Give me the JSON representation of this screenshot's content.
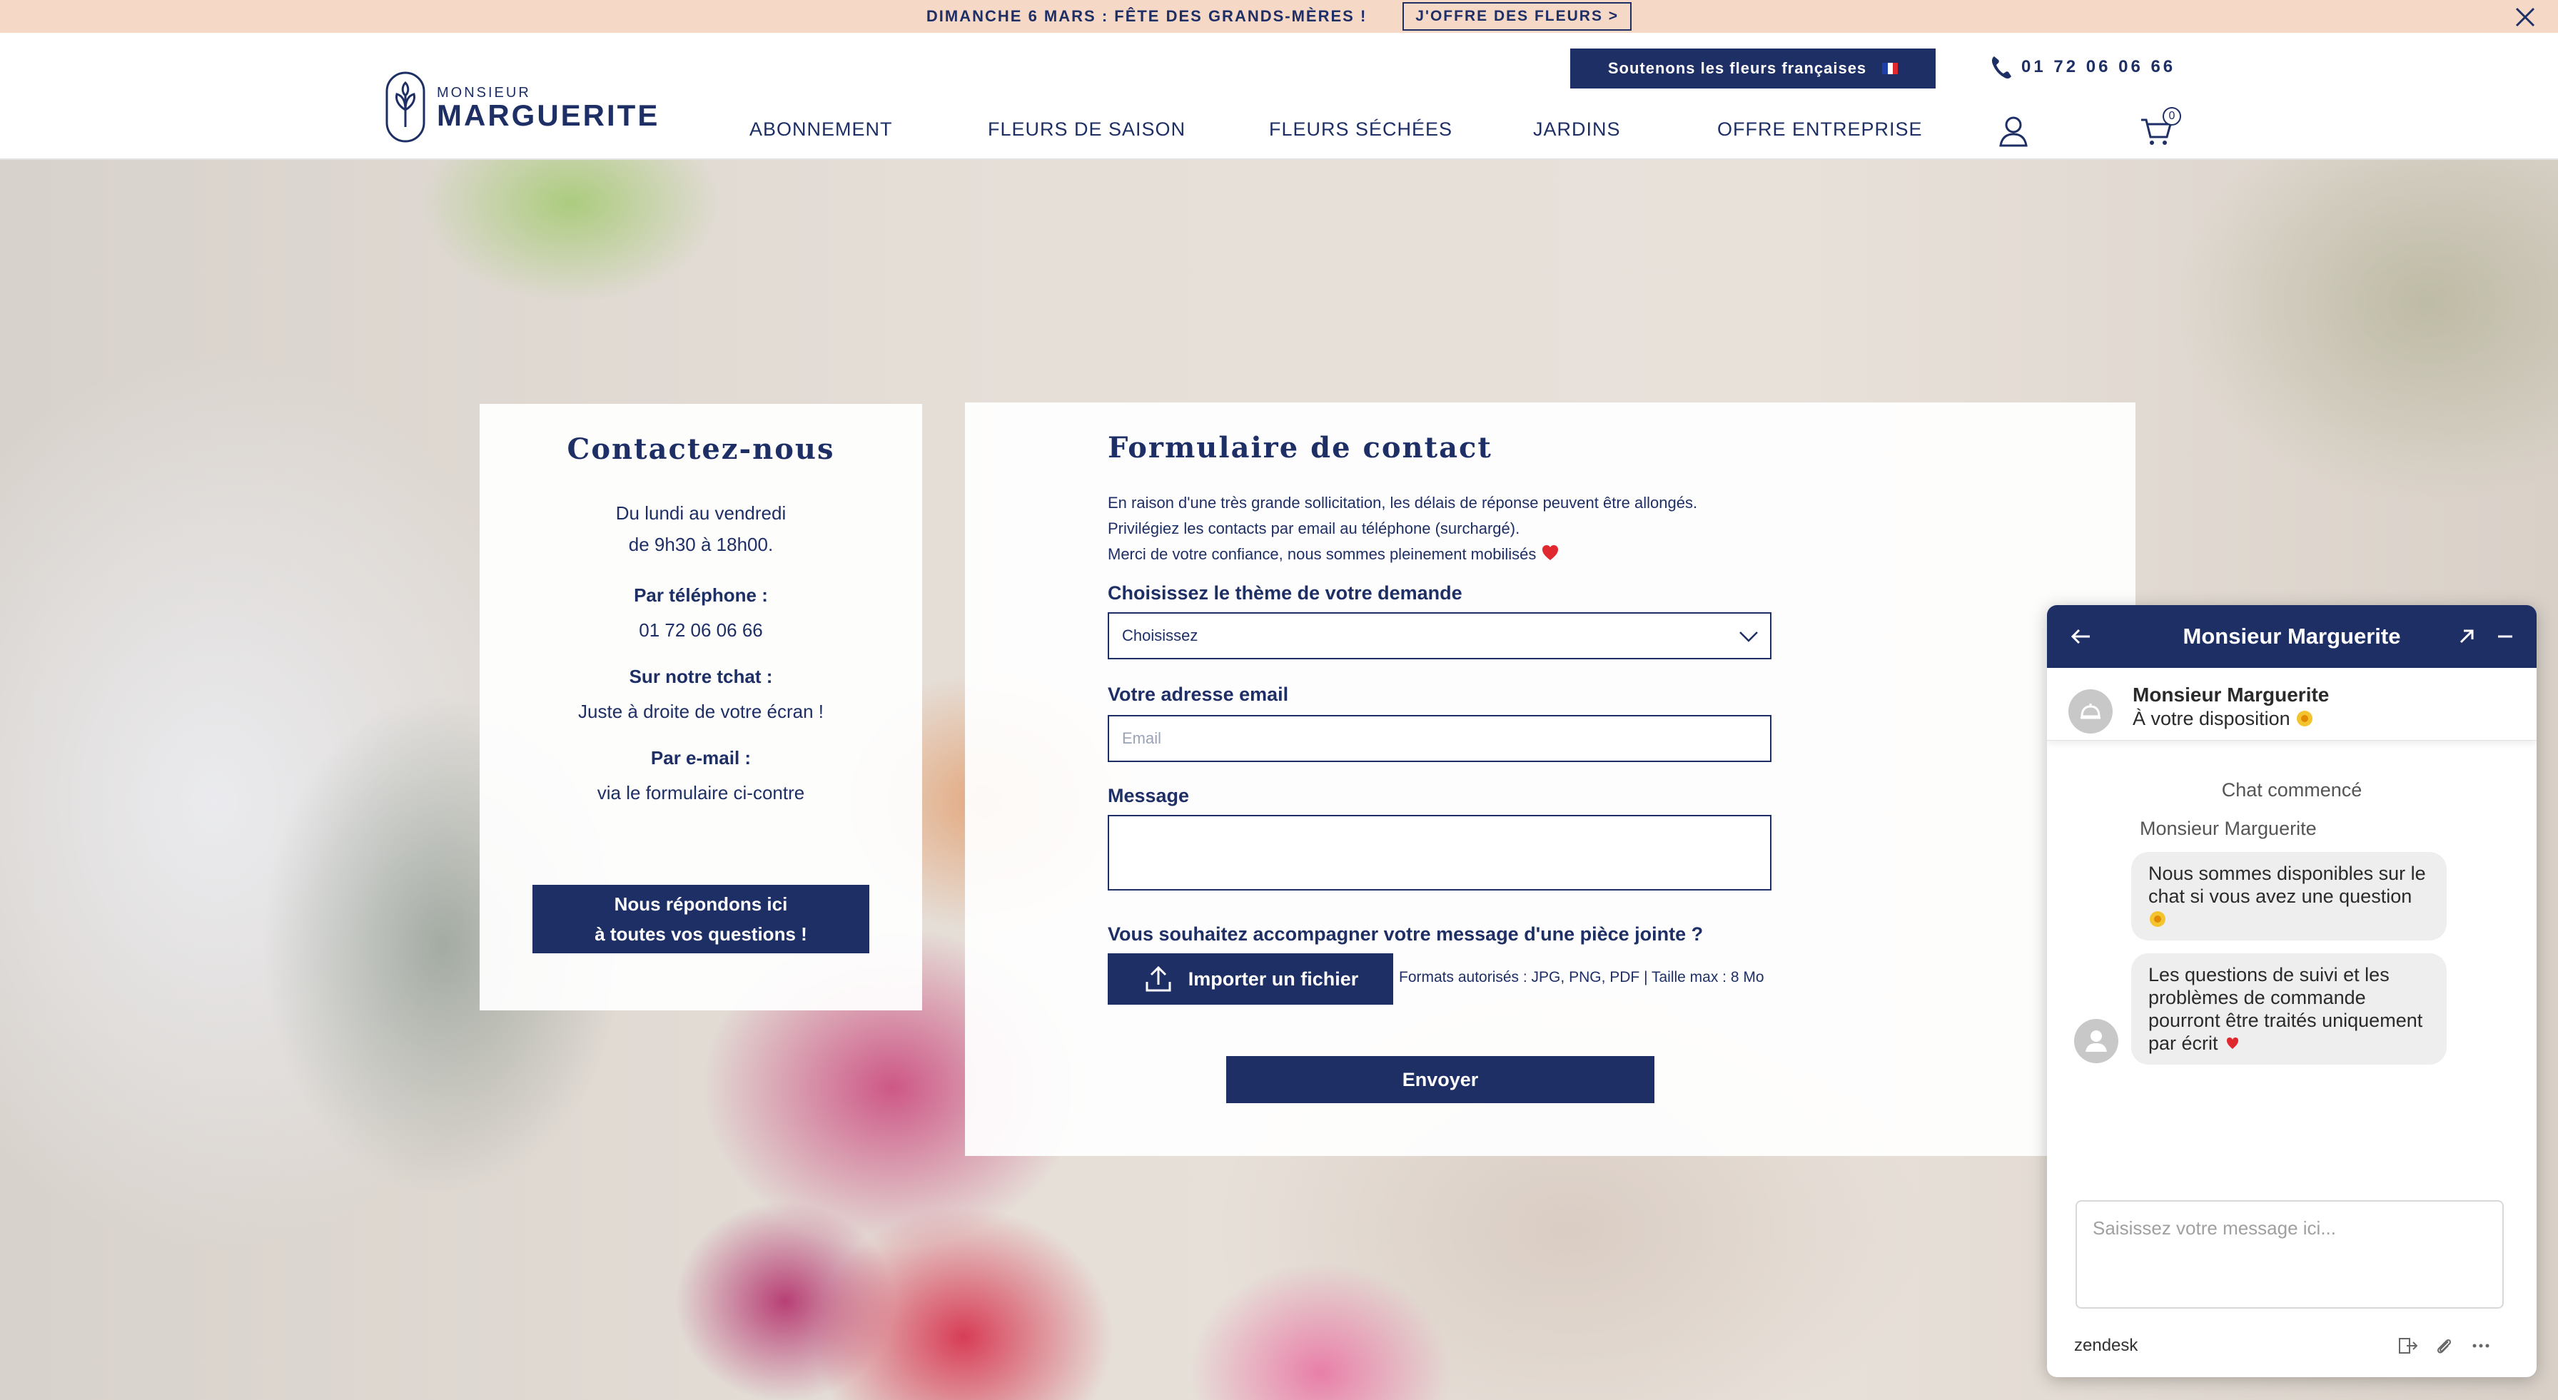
{
  "promo": {
    "text": "DIMANCHE 6 MARS : FÊTE DES GRANDS-MÈRES !",
    "cta": "J'OFFRE DES FLEURS >"
  },
  "header": {
    "logo_small": "MONSIEUR",
    "logo_big": "MARGUERITE",
    "support_label": "Soutenons les fleurs françaises",
    "phone": "01 72 06 06 66",
    "nav": [
      "ABONNEMENT",
      "FLEURS DE SAISON",
      "FLEURS SÉCHÉES",
      "JARDINS",
      "OFFRE ENTREPRISE"
    ],
    "cart_count": "0"
  },
  "contact": {
    "title": "Contactez-nous",
    "hours_line1": "Du lundi au vendredi",
    "hours_line2": "de 9h30 à 18h00.",
    "phone_label": "Par téléphone :",
    "phone_value": "01 72 06 06 66",
    "chat_label": "Sur notre tchat :",
    "chat_value": "Juste à droite de votre écran !",
    "email_label": "Par e-mail :",
    "email_value": "via le formulaire ci-contre",
    "reply_line1": "Nous répondons ici",
    "reply_line2": "à toutes vos questions !"
  },
  "form": {
    "title": "Formulaire de contact",
    "intro1": "En raison d'une très grande sollicitation, les délais de réponse peuvent être allongés.",
    "intro2": "Privilégiez les contacts par email au téléphone (surchargé).",
    "intro3": "Merci de votre confiance, nous sommes pleinement mobilisés",
    "theme_label": "Choisissez le thème de votre demande",
    "theme_value": "Choisissez",
    "email_label": "Votre adresse email",
    "email_placeholder": "Email",
    "message_label": "Message",
    "attach_label": "Vous souhaitez accompagner votre message d'une pièce jointe ?",
    "upload_label": "Importer un fichier",
    "formats": "Formats autorisés : JPG, PNG, PDF | Taille max : 8 Mo",
    "send_label": "Envoyer"
  },
  "chat": {
    "title": "Monsieur Marguerite",
    "agent_name": "Monsieur Marguerite",
    "agent_status": "À votre disposition",
    "started": "Chat commencé",
    "sender": "Monsieur Marguerite",
    "msg1": "Nous sommes disponibles sur le chat si vous avez une question",
    "msg2": "Les questions de suivi et les problèmes de commande pourront être traités uniquement par écrit",
    "input_placeholder": "Saisissez votre message ici...",
    "brand": "zendesk"
  },
  "colors": {
    "navy": "#1e2f66",
    "promo_bg": "#f6d8c7"
  }
}
